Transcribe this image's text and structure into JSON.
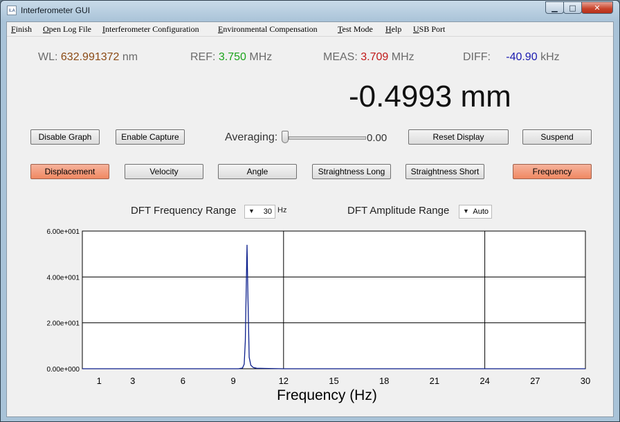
{
  "window": {
    "title": "Interferometer GUI",
    "app_icon_text": "ILA"
  },
  "menu": [
    {
      "accel": "F",
      "rest": "inish"
    },
    {
      "accel": "O",
      "rest": "pen Log File"
    },
    {
      "accel": "I",
      "rest": "nterferometer Configuration"
    },
    {
      "accel": "E",
      "rest": "nvironmental Compensation"
    },
    {
      "accel": "T",
      "rest": "est Mode"
    },
    {
      "accel": "H",
      "rest": "elp"
    },
    {
      "accel": "U",
      "rest": "SB Port"
    }
  ],
  "readouts": {
    "wl": {
      "label": "WL:",
      "value": "632.991372",
      "unit": "nm",
      "color": "#8b4a14"
    },
    "ref": {
      "label": "REF:",
      "value": "3.750",
      "unit": "MHz",
      "color": "#1aa31a"
    },
    "meas": {
      "label": "MEAS:",
      "value": "3.709",
      "unit": "MHz",
      "color": "#c01818"
    },
    "diff": {
      "label": "DIFF:",
      "value": "-40.90",
      "unit": "kHz",
      "color": "#1a1ab0"
    }
  },
  "measurement": "-0.4993 mm",
  "controls": {
    "disable_graph": "Disable Graph",
    "enable_capture": "Enable Capture",
    "averaging_label": "Averaging:",
    "averaging_value": "0.00",
    "averaging_level": 0,
    "reset_display": "Reset Display",
    "suspend": "Suspend"
  },
  "modes": [
    {
      "label": "Displacement",
      "active": true
    },
    {
      "label": "Velocity",
      "active": false
    },
    {
      "label": "Angle",
      "active": false
    },
    {
      "label": "Straightness Long",
      "active": false
    },
    {
      "label": "Straightness Short",
      "active": false
    },
    {
      "label": "Frequency",
      "active": true
    }
  ],
  "dft": {
    "freq_range_label": "DFT Frequency Range",
    "freq_range_value": "30",
    "freq_unit": "Hz",
    "amp_range_label": "DFT Amplitude Range",
    "amp_range_value": "Auto"
  },
  "chart_data": {
    "type": "line",
    "xlabel": "Frequency (Hz)",
    "ylabel": "",
    "xlim": [
      0,
      30
    ],
    "ylim": [
      0,
      60
    ],
    "x_ticks": [
      1,
      3,
      6,
      9,
      12,
      15,
      18,
      21,
      24,
      27,
      30
    ],
    "y_ticks": [
      0,
      20,
      40,
      60
    ],
    "y_tick_labels": [
      "0.00e+000",
      "2.00e+001",
      "4.00e+001",
      "6.00e+001"
    ],
    "vertical_gridlines": [
      12,
      24
    ],
    "horizontal_gridlines": [
      20,
      40
    ],
    "series": [
      {
        "color": "#0c1f8c",
        "x": [
          0,
          9.3,
          9.55,
          9.65,
          9.72,
          9.78,
          9.82,
          9.88,
          9.95,
          10.05,
          10.2,
          10.4,
          12,
          30
        ],
        "y": [
          0,
          0,
          0.3,
          2,
          12,
          38,
          54,
          30,
          5,
          1.5,
          0.5,
          0.2,
          0,
          0
        ]
      }
    ]
  }
}
